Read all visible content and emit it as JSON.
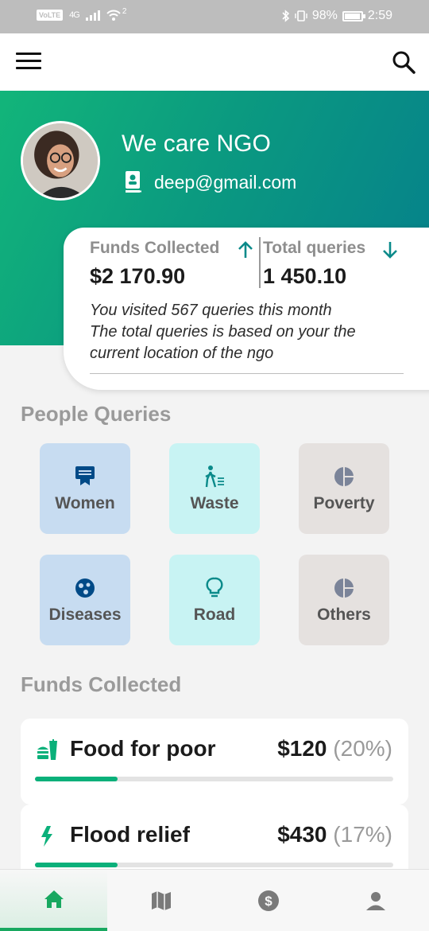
{
  "status_bar": {
    "volte": "VoLTE",
    "network": "4G",
    "wifi_badge": "2",
    "battery_percent": "98%",
    "battery_level": 0.98,
    "time": "2:59"
  },
  "profile": {
    "name": "We care NGO",
    "email": "deep@gmail.com"
  },
  "stats": {
    "funds_label": "Funds Collected",
    "funds_value": "$2 170.90",
    "queries_label": "Total queries",
    "queries_value": "1 450.10",
    "visit_text": "You visited 567 queries this month",
    "note_text": "The total queries is based on your the current location of the ngo"
  },
  "people_queries": {
    "title": "People Queries",
    "items": [
      {
        "label": "Women",
        "icon": "bill-icon",
        "color": "#004a87"
      },
      {
        "label": "Waste",
        "icon": "walk-icon",
        "color": "#0a8a8a"
      },
      {
        "label": "Poverty",
        "icon": "pie-icon",
        "color": "#7b8499"
      },
      {
        "label": "Diseases",
        "icon": "virus-icon",
        "color": "#004a87"
      },
      {
        "label": "Road",
        "icon": "bulb-icon",
        "color": "#0a8a8a"
      },
      {
        "label": "Others",
        "icon": "pie-icon",
        "color": "#7b8499"
      }
    ]
  },
  "funds": {
    "title": "Funds Collected",
    "items": [
      {
        "title": "Food for poor",
        "amount": "$120",
        "percent": "(20%)",
        "progress": 0.23,
        "icon": "fastfood-icon"
      },
      {
        "title": "Flood relief",
        "amount": "$430",
        "percent": "(17%)",
        "progress": 0.23,
        "icon": "bolt-icon"
      }
    ]
  },
  "nav": {
    "items": [
      "home-icon",
      "map-icon",
      "dollar-icon",
      "person-icon"
    ],
    "active": "home",
    "accent": "#18a860"
  }
}
